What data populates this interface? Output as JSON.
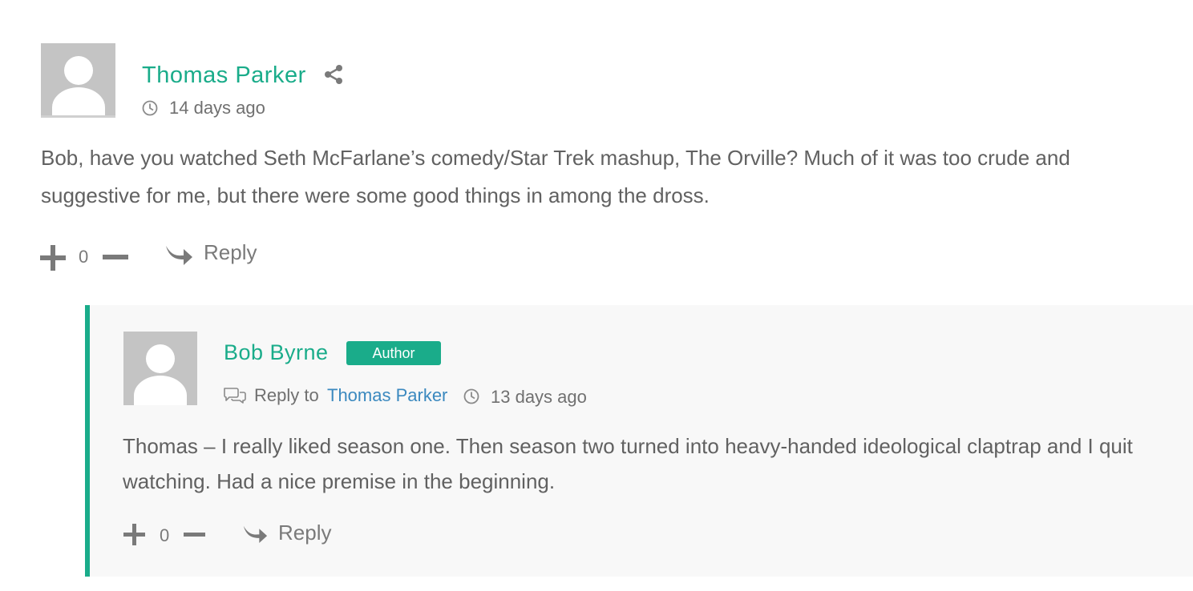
{
  "top_comment": {
    "author": "Thomas Parker",
    "time": "14 days ago",
    "text": "Bob, have you watched Seth McFarlane’s comedy/Star Trek mashup, The Orville? Much of it was too crude and suggestive for me, but there were some good things in among the dross.",
    "vote_count": "0",
    "reply_label": "Reply",
    "icons": {
      "share": "share-icon",
      "clock": "clock-icon",
      "upvote": "plus-icon",
      "downvote": "minus-icon",
      "reply": "reply-arrow-icon"
    }
  },
  "reply_comment": {
    "author": "Bob Byrne",
    "badge": "Author",
    "reply_to_label": "Reply to",
    "reply_to_name": "Thomas Parker",
    "time": "13 days ago",
    "text": "Thomas – I really liked season one. Then season two turned into heavy-handed ideological claptrap and I quit watching. Had a nice premise in the beginning.",
    "vote_count": "0",
    "reply_label": "Reply",
    "icons": {
      "reply_to": "speech-bubbles-icon",
      "clock": "clock-icon",
      "upvote": "plus-icon",
      "downvote": "minus-icon",
      "reply": "reply-arrow-icon"
    }
  },
  "colors": {
    "accent": "#1aac8a",
    "link": "#3b89bf",
    "text": "#616161",
    "reply_background": "#f8f8f8",
    "avatar": "#c4c4c4"
  }
}
